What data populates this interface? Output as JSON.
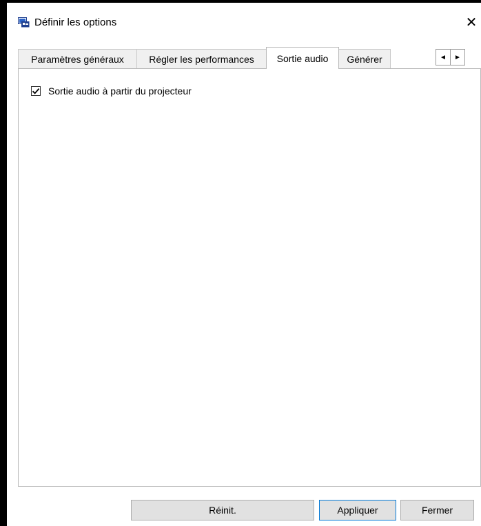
{
  "window": {
    "title": "Définir les options",
    "close_glyph": "✕",
    "app_icon": "projector-options-icon"
  },
  "tabs": [
    {
      "label": "Paramètres généraux",
      "active": false
    },
    {
      "label": "Régler les performances",
      "active": false
    },
    {
      "label": "Sortie audio",
      "active": true
    },
    {
      "label": "Générer",
      "active": false
    }
  ],
  "tab_scroll": {
    "left_glyph": "◄",
    "right_glyph": "►"
  },
  "panel": {
    "checkbox": {
      "label": "Sortie audio à partir du projecteur",
      "checked": true
    }
  },
  "buttons": {
    "reset_label": "Réinit.",
    "apply_label": "Appliquer",
    "close_label": "Fermer"
  }
}
